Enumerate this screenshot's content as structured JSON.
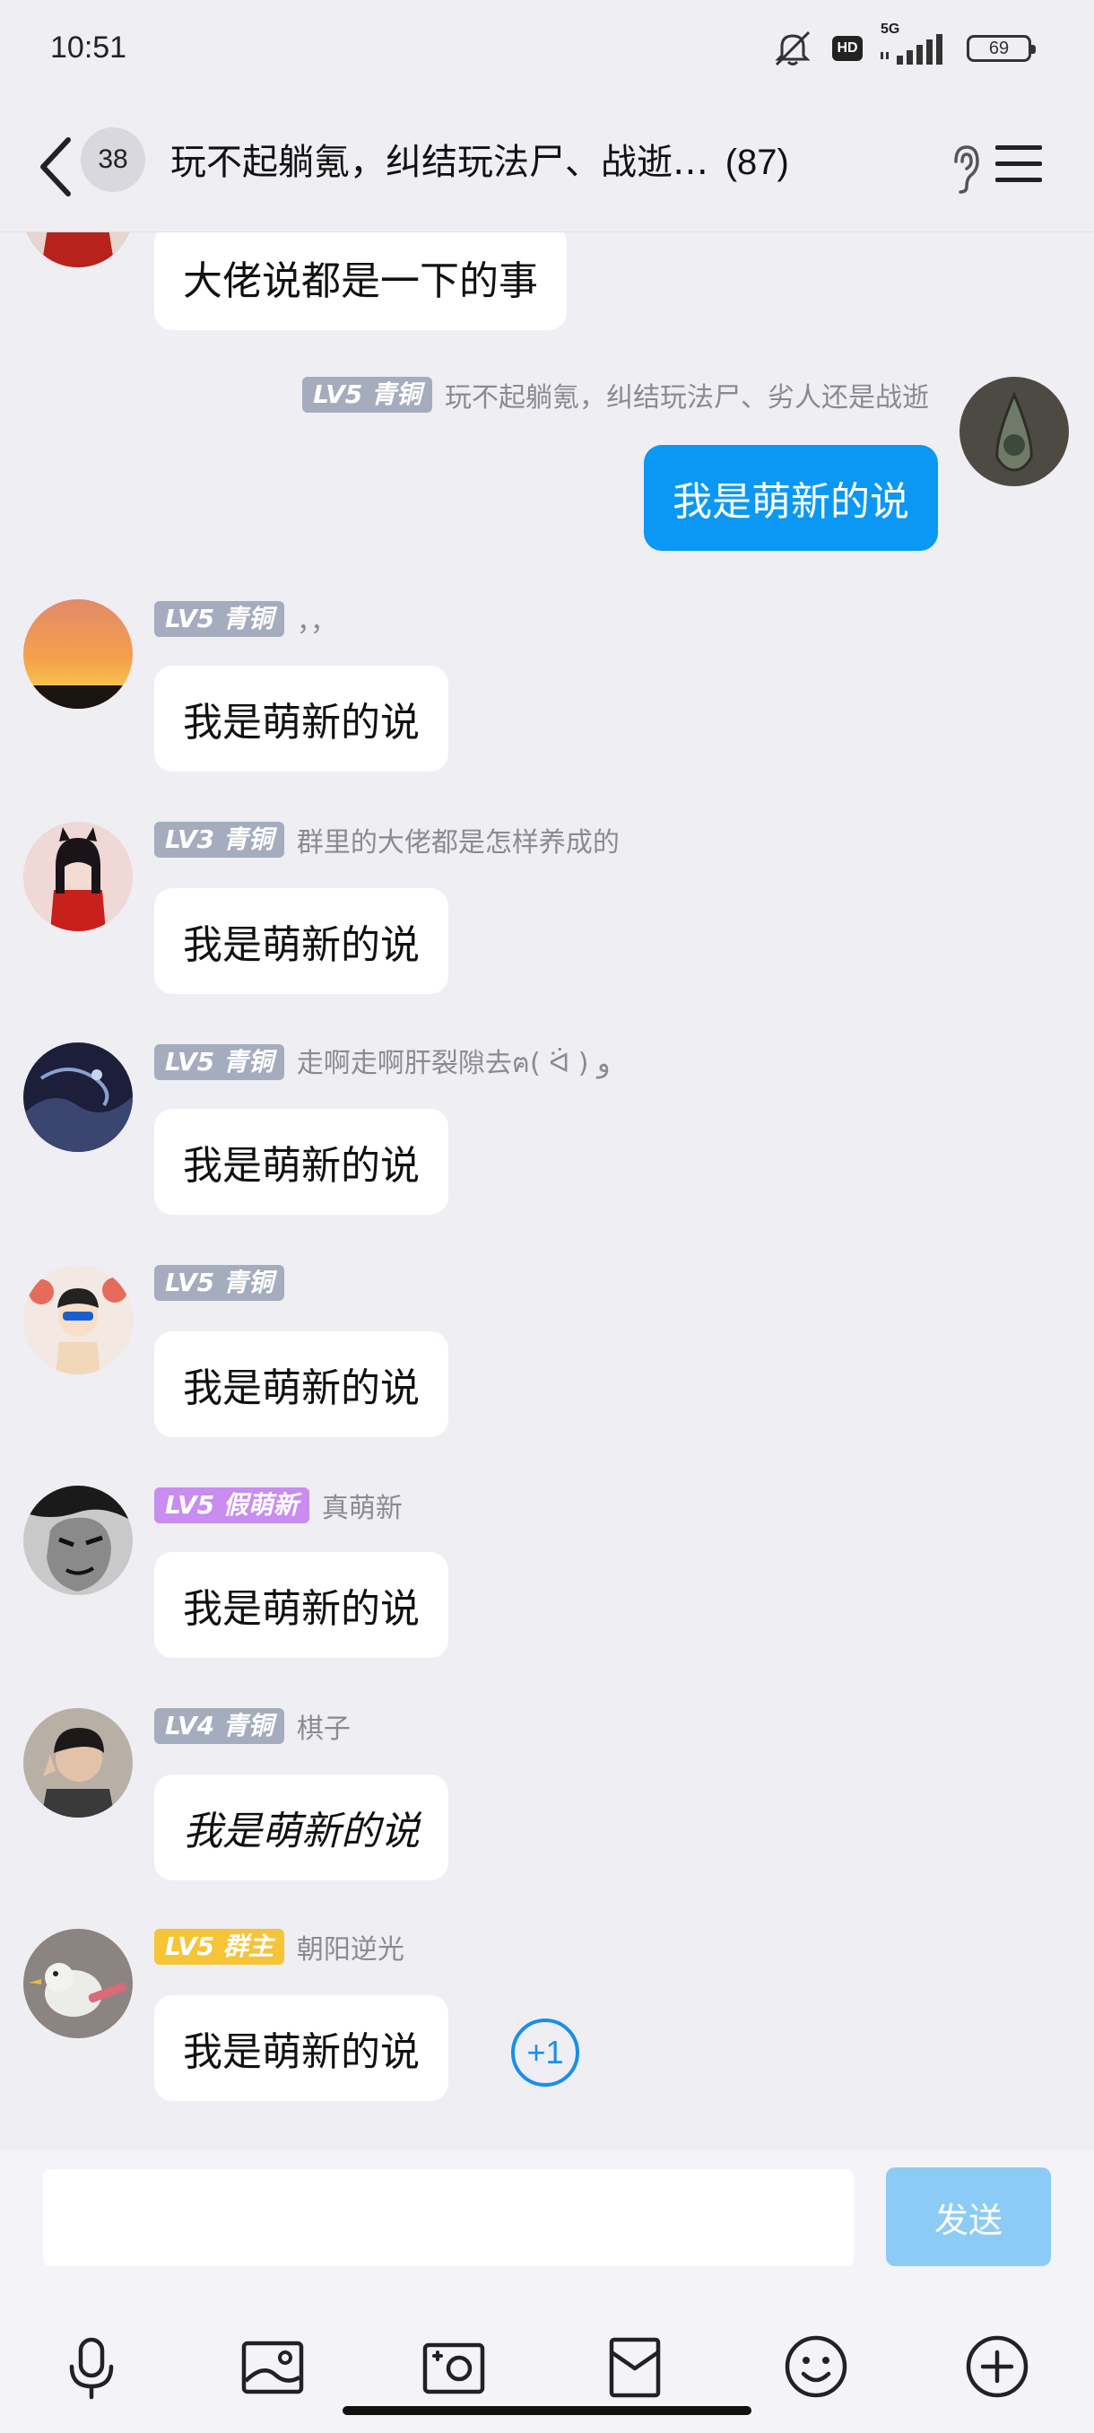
{
  "status": {
    "time": "10:51",
    "network": "5G",
    "hd": "HD",
    "battery": "69"
  },
  "header": {
    "unread": "38",
    "title": "玩不起躺氪，纠结玩法尸、战逝…",
    "member_count": "(87)"
  },
  "messages": [
    {
      "level": "",
      "name": "",
      "text": "大佬说都是一下的事",
      "self": false
    },
    {
      "level": "LV5 青铜",
      "name": "玩不起躺氪，纠结玩法尸、劣人还是战逝",
      "text": "我是萌新的说",
      "self": true
    },
    {
      "level": "LV5 青铜",
      "name": "，，",
      "text": "我是萌新的说",
      "self": false
    },
    {
      "level": "LV3 青铜",
      "name": "群里的大佬都是怎样养成的",
      "text": "我是萌新的说",
      "self": false
    },
    {
      "level": "LV5 青铜",
      "name": "走啊走啊肝裂隙去ฅ( ᐛ ) و",
      "text": "我是萌新的说",
      "self": false
    },
    {
      "level": "LV5 青铜",
      "name": "",
      "text": "我是萌新的说",
      "self": false
    },
    {
      "level": "LV5 假萌新",
      "name": "真萌新",
      "text": "我是萌新的说",
      "self": false
    },
    {
      "level": "LV4 青铜",
      "name": "棋子",
      "text": "我是萌新的说",
      "self": false
    },
    {
      "level": "LV5 群主",
      "name": "朝阳逆光",
      "text": "我是萌新的说",
      "self": false
    }
  ],
  "plus_one": "+1",
  "composer": {
    "placeholder": "",
    "send_label": "发送"
  },
  "colors": {
    "self_bubble": "#0b98f5",
    "badge_bronze": "#a4acbe",
    "badge_fake_newbie": "#c98cf0",
    "badge_owner": "#f5c437",
    "send_disabled": "#8dcbf7"
  },
  "icons": [
    "voice-icon",
    "image-icon",
    "camera-icon",
    "red-packet-icon",
    "emoji-icon",
    "plus-icon"
  ]
}
